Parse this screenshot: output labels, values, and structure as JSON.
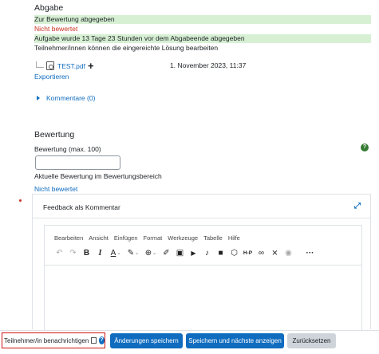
{
  "abgabe": {
    "heading": "Abgabe",
    "status_submitted": "Zur Bewertung abgegeben",
    "status_graded": "Nicht bewertet",
    "time_info": "Aufgabe wurde 13 Tage 23 Stunden vor dem Abgabeende abgegeben",
    "edit_info": "Teilnehmer/innen können die eingereichte Lösung bearbeiten",
    "file_name": "TEST.pdf",
    "file_date": "1. November 2023, 11:37",
    "export_link": "Exportieren",
    "comments_link": "Kommentare (0)"
  },
  "bewertung": {
    "heading": "Bewertung",
    "label": "Bewertung (max. 100)",
    "input_value": "",
    "current_grade_label": "Aktuelle Bewertung im Bewertungsbereich",
    "current_grade_link": "Nicht bewertet"
  },
  "feedback": {
    "title": "Feedback als Kommentar",
    "menu": [
      "Bearbeiten",
      "Ansicht",
      "Einfügen",
      "Format",
      "Werkzeuge",
      "Tabelle",
      "Hilfe"
    ],
    "toolbar_icons": [
      "undo-icon",
      "redo-icon",
      "bold-icon",
      "italic-icon",
      "text-color-icon",
      "highlight-icon",
      "link-world-icon",
      "pen-icon",
      "image-icon",
      "media-icon",
      "microphone-icon",
      "video-icon",
      "content-bank-icon",
      "h5p-icon",
      "link-icon",
      "unlink-icon",
      "eye-icon",
      "more-icon"
    ],
    "toolbar_glyphs": {
      "undo": "↶",
      "redo": "↷",
      "bold": "B",
      "italic": "I",
      "text_color": "A",
      "highlight": "✎",
      "world": "⊕",
      "pen": "✐",
      "image": "▣",
      "media": "▶",
      "mic": "♪",
      "video": "■",
      "content": "⬡",
      "h5p": "H-P",
      "link": "∞",
      "unlink": "⨯",
      "eye": "◉",
      "more": "···"
    }
  },
  "footer": {
    "notify_label": "Teilnehmer/in benachrichtigen",
    "save_label": "Änderungen speichern",
    "save_next_label": "Speichern und nächste anzeigen",
    "reset_label": "Zurücksetzen"
  },
  "colors": {
    "accent": "#0f6cbf",
    "success_bg": "#d7f0d4",
    "danger": "#ca3120",
    "help_green": "#357a32"
  }
}
